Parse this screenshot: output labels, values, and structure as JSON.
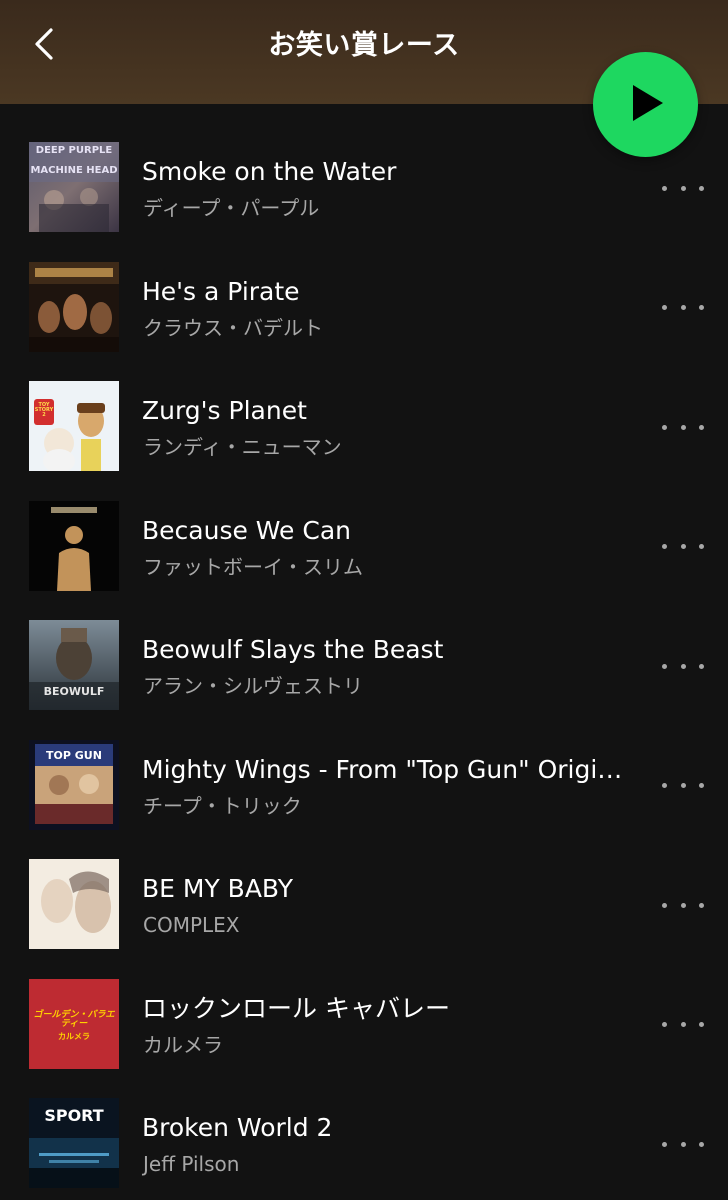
{
  "header": {
    "title": "お笑い賞レース",
    "back_icon": "chevron-left-icon",
    "play_icon": "play-icon",
    "play_color": "#1ed760"
  },
  "tracks": [
    {
      "title": "Smoke on the Water",
      "artist": "ディープ・パープル",
      "art_text": [
        "DEEP PURPLE",
        "MACHINE HEAD"
      ]
    },
    {
      "title": "He's a Pirate",
      "artist": "クラウス・バデルト",
      "art_text": []
    },
    {
      "title": "Zurg's Planet",
      "artist": "ランディ・ニューマン",
      "art_text": [
        "TOY STORY 2"
      ]
    },
    {
      "title": "Because We Can",
      "artist": "ファットボーイ・スリム",
      "art_text": []
    },
    {
      "title": "Beowulf Slays the Beast",
      "artist": "アラン・シルヴェストリ",
      "art_text": [
        "BEOWULF"
      ]
    },
    {
      "title": "Mighty Wings - From \"Top Gun\" Original Motion Picture Soundtrack",
      "artist": "チープ・トリック",
      "art_text": [
        "TOP GUN"
      ]
    },
    {
      "title": "BE MY BABY",
      "artist": "COMPLEX",
      "art_text": []
    },
    {
      "title": "ロックンロール キャバレー",
      "artist": "カルメラ",
      "art_text": [
        "ゴールデン・バラエティー",
        "カルメラ"
      ]
    },
    {
      "title": "Broken World 2",
      "artist": "Jeff Pilson",
      "art_text": [
        "SPORT"
      ]
    }
  ]
}
